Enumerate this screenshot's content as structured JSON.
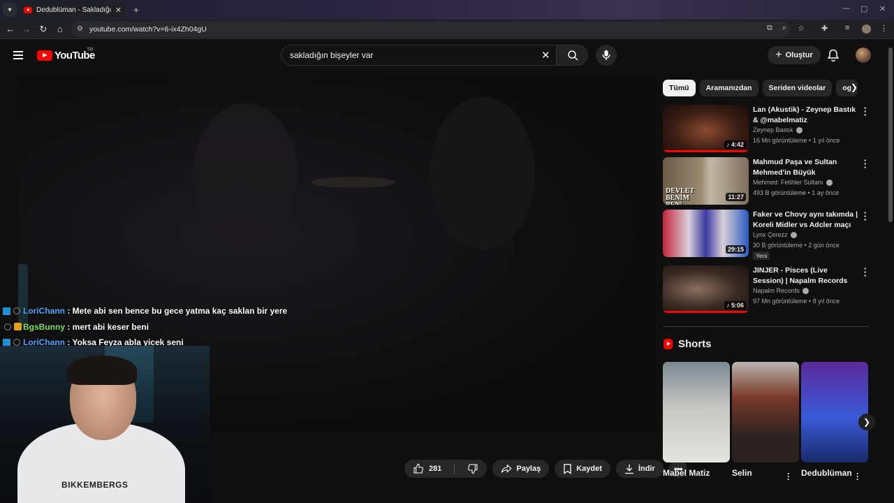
{
  "browser": {
    "tab_title": "Dedublüman - Sakladığın B",
    "url": "youtube.com/watch?v=6-ix4Zh04gU"
  },
  "header": {
    "logo_text": "YouTube",
    "country": "TR",
    "search_value": "sakladığın bişeyler var",
    "create_label": "Oluştur"
  },
  "actions": {
    "like_count": "281",
    "share_label": "Paylaş",
    "save_label": "Kaydet",
    "download_label": "İndir"
  },
  "chat": [
    {
      "user": "LoriChann",
      "message": ": Mete abi sen bence bu gece yatma kaç saklan bir yere"
    },
    {
      "user": "BgsBunny",
      "message": ": mert abi keser beni"
    },
    {
      "user": "LoriChann",
      "message": ": Yoksa Feyza abla yicek seni"
    }
  ],
  "webcam": {
    "shirt_text": "BIKKEMBERGS"
  },
  "chips": [
    "Tümü",
    "Aramanızdan",
    "Seriden videolar",
    "og"
  ],
  "recommendations": [
    {
      "title": "Lan (Akustik) - Zeynep Bastık & @mabelmatiz",
      "channel": "Zeynep Bastık",
      "meta": "16 Mn görüntüleme • 1 yıl önce",
      "duration": "4:42",
      "badge": ""
    },
    {
      "title": "Mahmud Paşa ve Sultan Mehmed'in Büyük Restleşmesi...",
      "channel": "Mehmed: Fetihler Sultanı",
      "meta": "493 B görüntüleme • 1 ay önce",
      "duration": "11:27",
      "badge": ""
    },
    {
      "title": "Faker ve Chovy aynı takımda | Koreli Midler vs Adcler maçı ...",
      "channel": "Lynx Çerezz",
      "meta": "30 B görüntüleme • 2 gün önce",
      "duration": "29:15",
      "badge": "Yeni"
    },
    {
      "title": "JINJER - Pisces (Live Session) | Napalm Records",
      "channel": "Napalm Records",
      "meta": "97 Mn görüntüleme • 8 yıl önce",
      "duration": "5:06",
      "badge": ""
    }
  ],
  "thumb_texts": {
    "rec2_overlay": "DEVLET BENİM BEN!"
  },
  "shorts": {
    "heading": "Shorts",
    "items": [
      {
        "title": "Mabel Matiz"
      },
      {
        "title": "Selin"
      },
      {
        "title": "Dedublüman"
      }
    ]
  }
}
